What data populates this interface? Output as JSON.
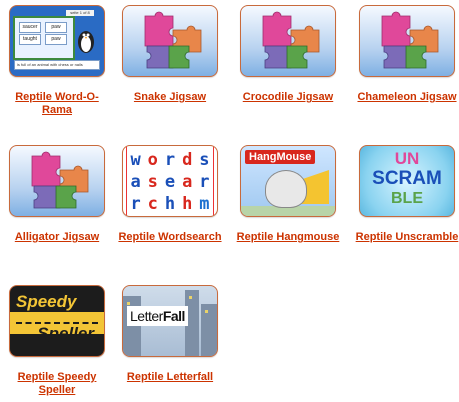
{
  "games": [
    {
      "id": "word-o-rama",
      "label": "Reptile Word-O-Rama",
      "thumb": "word-o-rama-screenshot",
      "thumb_text": {
        "word1": "saucer",
        "word2": "paw",
        "word3": "taught",
        "word4": "paw",
        "hint": "is full of an animal with chess or nails",
        "corner": "seite 1 of 8"
      }
    },
    {
      "id": "snake-jigsaw",
      "label": "Snake Jigsaw",
      "thumb": "jigsaw-puzzle-icon"
    },
    {
      "id": "crocodile-jigsaw",
      "label": "Crocodile Jigsaw",
      "thumb": "jigsaw-puzzle-icon"
    },
    {
      "id": "chameleon-jigsaw",
      "label": "Chameleon Jigsaw",
      "thumb": "jigsaw-puzzle-icon"
    },
    {
      "id": "alligator-jigsaw",
      "label": "Alligator Jigsaw",
      "thumb": "jigsaw-puzzle-icon"
    },
    {
      "id": "wordsearch",
      "label": "Reptile Wordsearch",
      "thumb": "wordsearch-grid",
      "thumb_text": {
        "letters": [
          "w",
          "o",
          "r",
          "d",
          "s",
          "a",
          "s",
          "e",
          "a",
          "r",
          "r",
          "c",
          "h",
          "h",
          "m"
        ]
      }
    },
    {
      "id": "hangmouse",
      "label": "Reptile Hangmouse",
      "thumb": "hangmouse-logo",
      "thumb_text": {
        "title": "HangMouse"
      }
    },
    {
      "id": "unscramble",
      "label": "Reptile Unscramble",
      "thumb": "unscramble-logo",
      "thumb_text": {
        "line1": "UN",
        "line2": "SCRAM",
        "line3": "BLE"
      }
    },
    {
      "id": "speedy-speller",
      "label": "Reptile Speedy Speller",
      "thumb": "speedy-speller-logo",
      "thumb_text": {
        "line1": "Speedy",
        "line2": "Speller"
      }
    },
    {
      "id": "letterfall",
      "label": "Reptile Letterfall",
      "thumb": "letterfall-logo",
      "thumb_text": {
        "part1": "Letter",
        "part2": "Fall"
      }
    }
  ],
  "colors": {
    "link": "#cc3300",
    "thumb_border": "#c86a3c",
    "puzzle_pink": "#e0489a",
    "puzzle_green": "#5aa34a",
    "puzzle_orange": "#e8864a",
    "puzzle_purple": "#7c6bb8"
  }
}
